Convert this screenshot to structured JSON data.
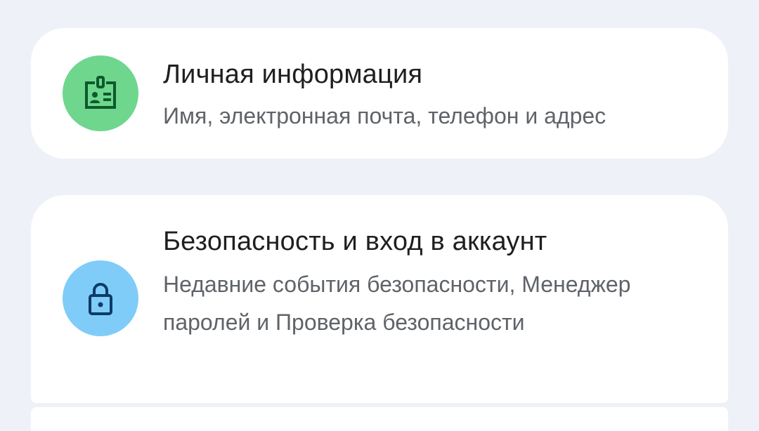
{
  "items": [
    {
      "title": "Личная информация",
      "subtitle": "Имя, электронная почта, телефон и адрес",
      "icon": "badge-icon",
      "icon_bg": "#6fd68e",
      "icon_fg": "#0d5a2c"
    },
    {
      "title": "Безопасность и вход в аккаунт",
      "subtitle": "Недавние события безопасности, Менеджер паролей и Проверка безопасности",
      "icon": "lock-icon",
      "icon_bg": "#7fccf8",
      "icon_fg": "#0b3b66"
    }
  ]
}
